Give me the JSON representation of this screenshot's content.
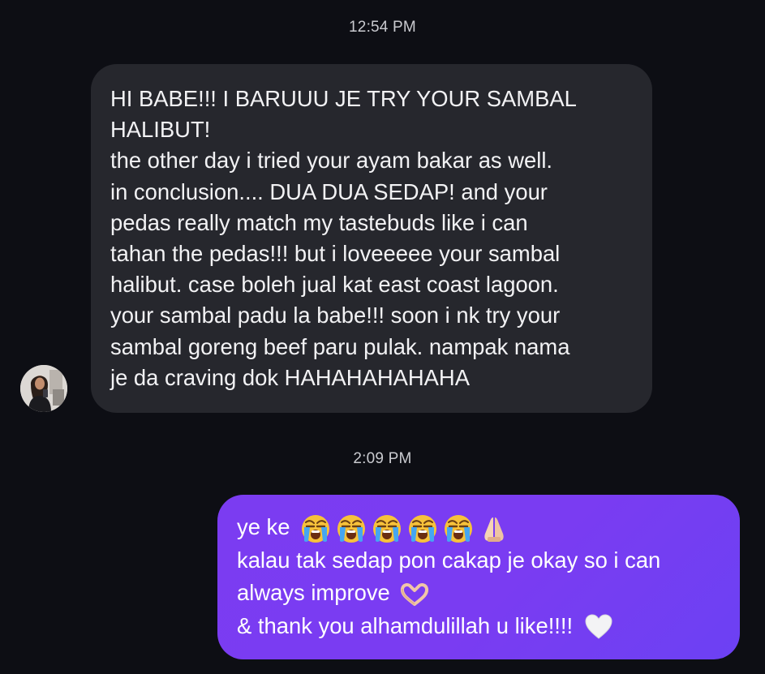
{
  "conversation": {
    "timestamp_1": "12:54 PM",
    "timestamp_2": "2:09 PM",
    "incoming_message": {
      "lines": [
        "HI BABE!!! I BARUUU JE TRY YOUR SAMBAL",
        "HALIBUT!",
        "the other day i tried your ayam bakar as well.",
        "in conclusion.... DUA DUA SEDAP! and your",
        "pedas really match my tastebuds like i can",
        "tahan the pedas!!! but i loveeeee your sambal",
        "halibut. case boleh jual kat east coast lagoon.",
        "your sambal padu la babe!!! soon i nk try your",
        "sambal goreng beef paru pulak. nampak nama",
        "je da craving dok HAHAHAHAHAHA"
      ]
    },
    "outgoing_message": {
      "line_1": "ye ke",
      "line_2": "kalau tak sedap pon cakap je okay so i can",
      "line_3": "always improve",
      "line_4": "& thank you alhamdulillah u like!!!!",
      "emojis_line_1": [
        "loudly-crying-face",
        "loudly-crying-face",
        "loudly-crying-face",
        "loudly-crying-face",
        "loudly-crying-face",
        "folded-hands"
      ],
      "emoji_line_3": "heart-hands",
      "emoji_line_4": "white-heart"
    },
    "colors": {
      "background": "#0d0e14",
      "incoming_bubble": "#26272d",
      "outgoing_bubble": "#7a3cf2"
    }
  }
}
